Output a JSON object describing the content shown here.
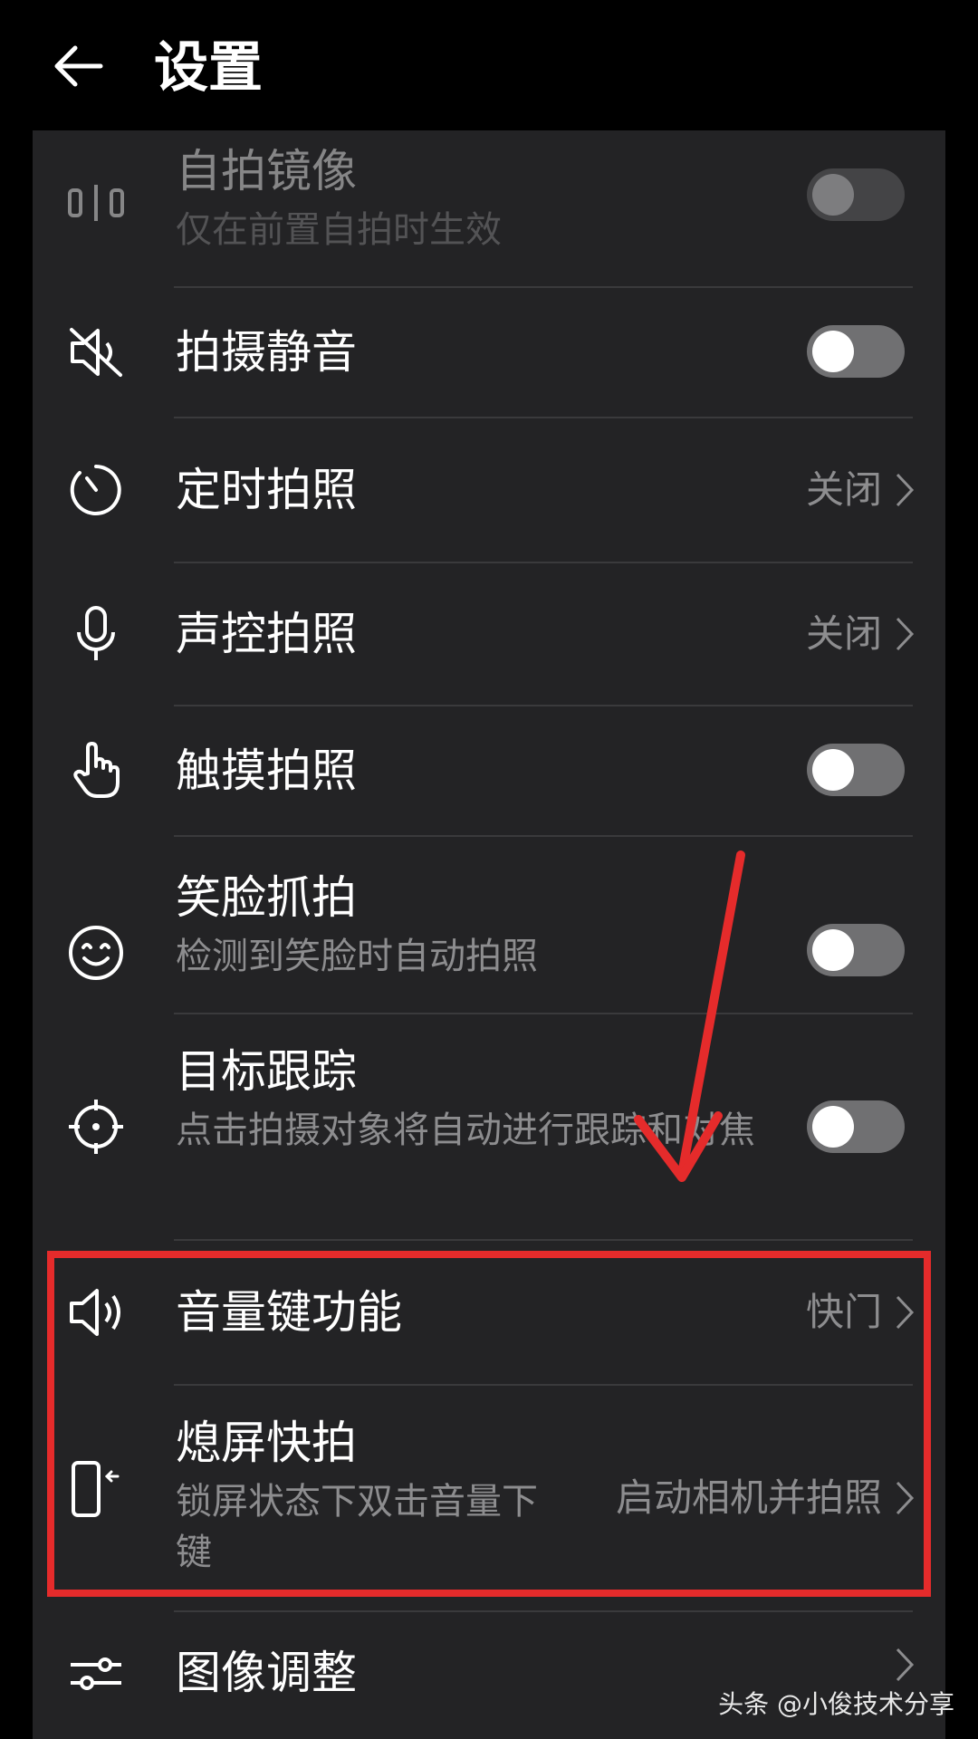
{
  "header": {
    "title": "设置",
    "back_icon": "arrow-left-icon"
  },
  "settings": {
    "mirror": {
      "title": "自拍镜像",
      "subtitle": "仅在前置自拍时生效",
      "icon": "mirror-icon",
      "enabled": false,
      "dimmed": true
    },
    "mute": {
      "title": "拍摄静音",
      "icon": "mute-icon",
      "enabled": false
    },
    "timer": {
      "title": "定时拍照",
      "value": "关闭",
      "icon": "timer-icon"
    },
    "voice": {
      "title": "声控拍照",
      "value": "关闭",
      "icon": "microphone-icon"
    },
    "touch": {
      "title": "触摸拍照",
      "icon": "touch-hand-icon",
      "enabled": false
    },
    "smile": {
      "title": "笑脸抓拍",
      "subtitle": "检测到笑脸时自动拍照",
      "icon": "smile-icon",
      "enabled": false
    },
    "tracking": {
      "title": "目标跟踪",
      "subtitle": "点击拍摄对象将自动进行跟踪和对焦",
      "icon": "target-icon",
      "enabled": false
    },
    "volume_key": {
      "title": "音量键功能",
      "value": "快门",
      "icon": "speaker-icon"
    },
    "quick_snap": {
      "title": "熄屏快拍",
      "subtitle": "锁屏状态下双击音量下键",
      "value": "启动相机并拍照",
      "icon": "phone-quick-snap-icon"
    },
    "image_adjust": {
      "title": "图像调整",
      "icon": "sliders-icon"
    }
  },
  "annotation": {
    "color": "#e52b2b"
  },
  "watermark": "头条 @小俊技术分享"
}
